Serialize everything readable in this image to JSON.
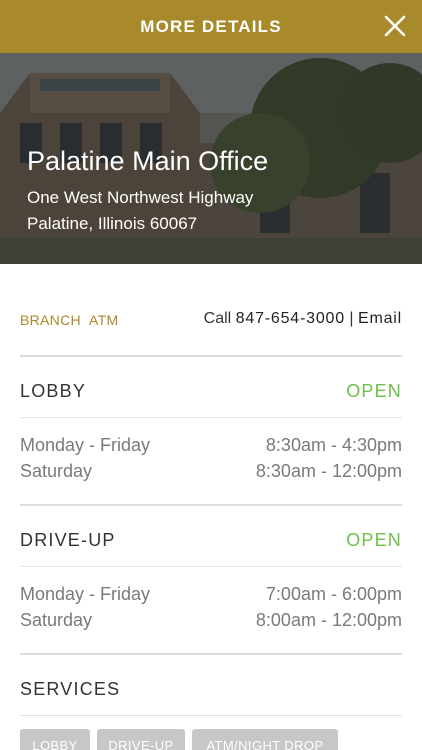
{
  "header": {
    "title": "MORE DETAILS",
    "close_icon": "close-icon"
  },
  "branch": {
    "name": "Palatine Main Office",
    "address_line1": "One West Northwest Highway",
    "address_line2": "Palatine, Illinois 60067"
  },
  "links": {
    "branch_label": "BRANCH",
    "atm_label": "ATM",
    "call_prefix": "Call",
    "phone": "847-654-3000",
    "separator": "|",
    "email_label": "Email"
  },
  "lobby": {
    "title": "LOBBY",
    "status": "OPEN",
    "hours": [
      {
        "days": "Monday - Friday",
        "time": "8:30am - 4:30pm"
      },
      {
        "days": "Saturday",
        "time": "8:30am - 12:00pm"
      }
    ]
  },
  "drive_up": {
    "title": "DRIVE-UP",
    "status": "OPEN",
    "hours": [
      {
        "days": "Monday - Friday",
        "time": "7:00am - 6:00pm"
      },
      {
        "days": "Saturday",
        "time": "8:00am - 12:00pm"
      }
    ]
  },
  "services": {
    "title": "SERVICES",
    "items": [
      "LOBBY",
      "DRIVE-UP",
      "ATM/NIGHT DROP"
    ]
  },
  "colors": {
    "header_bg": "#a88a2a",
    "accent_gold": "#a88a2a",
    "open_green": "#6cc04a",
    "chip_bg": "#c7c7c7"
  }
}
